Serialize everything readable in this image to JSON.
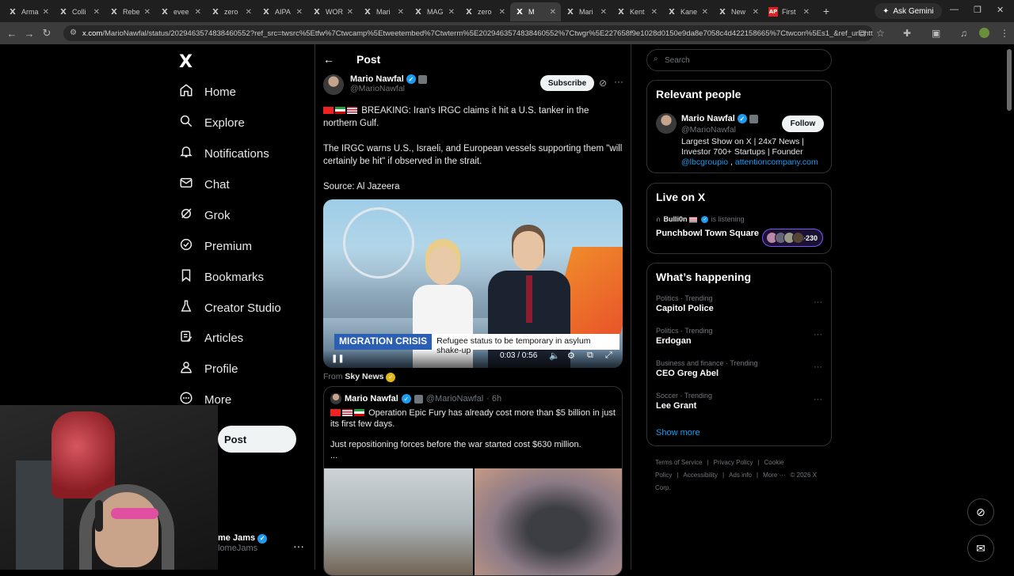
{
  "browser": {
    "tabs": [
      {
        "label": "Arma",
        "favicon": "X"
      },
      {
        "label": "Colli",
        "favicon": "X"
      },
      {
        "label": "Rebe",
        "favicon": "X"
      },
      {
        "label": "evee",
        "favicon": "X"
      },
      {
        "label": "zero",
        "favicon": "X"
      },
      {
        "label": "AIPA",
        "favicon": "X"
      },
      {
        "label": "WOR",
        "favicon": "X"
      },
      {
        "label": "Mari",
        "favicon": "X"
      },
      {
        "label": "MAG",
        "favicon": "X"
      },
      {
        "label": "zero",
        "favicon": "X"
      },
      {
        "label": "M",
        "favicon": "X",
        "active": true
      },
      {
        "label": "Mari",
        "favicon": "X"
      },
      {
        "label": "Kent",
        "favicon": "X"
      },
      {
        "label": "Kane",
        "favicon": "X"
      },
      {
        "label": "New",
        "favicon": "X"
      },
      {
        "label": "First",
        "favicon": "AP"
      }
    ],
    "gemini_label": "Ask Gemini",
    "url_site": "x.com",
    "url_rest": "/MarioNawfal/status/2029463574838460552?ref_src=twsrc%5Etfw%7Ctwcamp%5Etweetembed%7Ctwterm%5E2029463574838460552%7Ctwgr%5E227658f9e1028d0150e9da8e7058c4d422158665%7Ctwcon%5Es1_&ref_url=http..."
  },
  "nav": {
    "logo": "X",
    "items": [
      {
        "label": "Home",
        "icon": "home-icon"
      },
      {
        "label": "Explore",
        "icon": "search-icon"
      },
      {
        "label": "Notifications",
        "icon": "bell-icon"
      },
      {
        "label": "Chat",
        "icon": "mail-icon"
      },
      {
        "label": "Grok",
        "icon": "grok-icon"
      },
      {
        "label": "Premium",
        "icon": "premium-icon"
      },
      {
        "label": "Bookmarks",
        "icon": "bookmark-icon"
      },
      {
        "label": "Creator Studio",
        "icon": "flask-icon"
      },
      {
        "label": "Articles",
        "icon": "article-icon"
      },
      {
        "label": "Profile",
        "icon": "person-icon"
      },
      {
        "label": "More",
        "icon": "more-circle-icon"
      }
    ],
    "post_label": "Post",
    "account_name": "me Jams",
    "account_handle": "lomeJams"
  },
  "post": {
    "header": "Post",
    "author_name": "Mario Nawfal",
    "author_handle": "@MarioNawfal",
    "subscribe_label": "Subscribe",
    "paragraph1": "BREAKING: Iran's IRGC claims it hit a U.S. tanker in the northern Gulf.",
    "paragraph2": "The IRGC warns U.S., Israeli, and European vessels supporting them \"will certainly be hit\" if observed in the strait.",
    "paragraph3": "Source: Al Jazeera",
    "video": {
      "banner_tag": "MIGRATION CRISIS",
      "banner_text": "Refugee status to be temporary in asylum shake-up",
      "time": "0:03 / 0:56"
    },
    "from_label": "From",
    "from_source": "Sky News",
    "quote": {
      "author_name": "Mario Nawfal",
      "author_handle": "@MarioNawfal",
      "time": "· 6h",
      "line1": "Operation Epic Fury has already cost more than $5 billion in just its first few days.",
      "line2": "Just repositioning forces before the war started cost $630 million.",
      "ellipsis": "..."
    }
  },
  "sidebar": {
    "search_placeholder": "Search",
    "relevant": {
      "title": "Relevant people",
      "name": "Mario Nawfal",
      "handle": "@MarioNawfal",
      "follow_label": "Follow",
      "bio": "Largest Show on X | 24x7 News | Investor 700+ Startups | Founder",
      "link1": "@lbcgroupio",
      "sep": " , ",
      "link2": "attentioncompany.com"
    },
    "live": {
      "title": "Live on X",
      "user": "Bulli0n",
      "status": "is listening",
      "space_title": "Punchbowl Town Square",
      "count": "+230"
    },
    "happening": {
      "title": "What’s happening",
      "trends": [
        {
          "category": "Politics · Trending",
          "name": "Capitol Police"
        },
        {
          "category": "Politics · Trending",
          "name": "Erdogan"
        },
        {
          "category": "Business and finance · Trending",
          "name": "CEO Greg Abel"
        },
        {
          "category": "Soccer · Trending",
          "name": "Lee Grant"
        }
      ],
      "show_more": "Show more"
    },
    "footer": [
      "Terms of Service",
      "|",
      "Privacy Policy",
      "|",
      "Cookie Policy",
      "|",
      "Accessibility",
      "|",
      "Ads info",
      "|",
      "More ···",
      "© 2026 X Corp."
    ]
  },
  "colors": {
    "accent": "#1d9bf0",
    "background": "#000000",
    "border": "#2f3336"
  }
}
